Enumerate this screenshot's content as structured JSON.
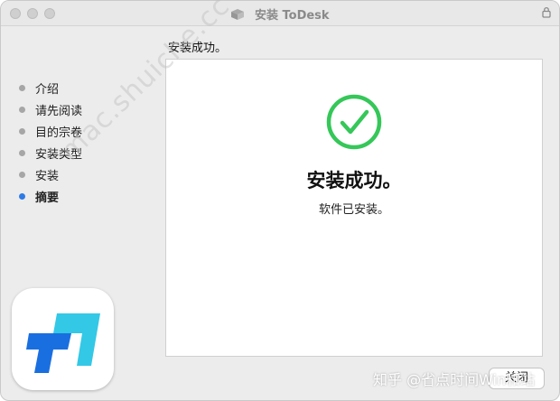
{
  "window": {
    "title": "安装 ToDesk",
    "section_title": "安装成功。"
  },
  "sidebar": {
    "items": [
      {
        "label": "介绍",
        "active": false
      },
      {
        "label": "请先阅读",
        "active": false
      },
      {
        "label": "目的宗卷",
        "active": false
      },
      {
        "label": "安装类型",
        "active": false
      },
      {
        "label": "安装",
        "active": false
      },
      {
        "label": "摘要",
        "active": true
      }
    ]
  },
  "content": {
    "status_icon": "success-check-icon",
    "headline": "安装成功。",
    "message": "软件已安装。"
  },
  "footer": {
    "close_label": "关闭"
  },
  "overlay": {
    "watermark": "mac.shuiche.cc",
    "credit": "知乎 @省点时间Win和站"
  },
  "colors": {
    "success_green": "#35c759",
    "active_step_blue": "#2d7be6",
    "brand_blue": "#1a6fe0",
    "brand_cyan": "#33c8e6"
  }
}
